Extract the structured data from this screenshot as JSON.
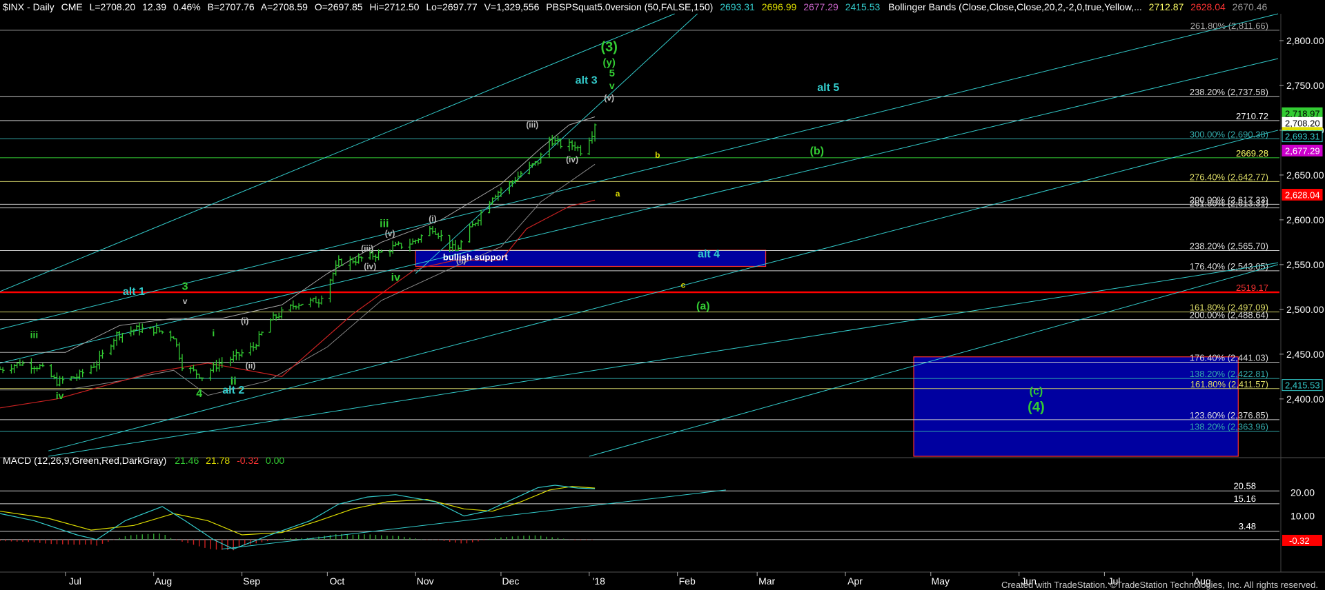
{
  "header": {
    "symbol": "$INX - Daily",
    "exchange": "CME",
    "last": "L=2708.20",
    "change": "12.39",
    "pct": "0.46%",
    "bid": "B=2707.76",
    "ask": "A=2708.59",
    "open": "O=2697.85",
    "high": "Hi=2712.50",
    "low": "Lo=2697.77",
    "volume": "V=1,329,556",
    "indicator_name": "PBSPSquat5.0version (50,FALSE,150)",
    "indicator_values": [
      "2693.31",
      "2696.99",
      "2677.29",
      "2415.53"
    ],
    "bb_name": "Bollinger Bands (Close,Close,Close,20,2,-2,0,true,Yellow,...",
    "bb_values": [
      "2712.87",
      "2628.04",
      "2670.46"
    ]
  },
  "colors": {
    "background": "#000000",
    "bar": "#33cc33",
    "trend_line": "#33cccc",
    "bb_line": "#aaaaaa",
    "support_box": "#0000a0",
    "box_border": "#ff3333",
    "wave_green": "#33cc33",
    "wave_cyan": "#33cccc",
    "wave_yellow": "#dddd00",
    "wave_gray": "#bbbbbb",
    "red_line": "#ff0000"
  },
  "chart_data": {
    "type": "ohlc",
    "price_axis": {
      "ylim": [
        2336,
        2830
      ],
      "ticks": [
        "2,800.00",
        "2,750.00",
        "2,700.00",
        "2,650.00",
        "2,600.00",
        "2,550.00",
        "2,500.00",
        "2,450.00",
        "2,400.00"
      ],
      "tick_values": [
        2800,
        2750,
        2700,
        2650,
        2600,
        2550,
        2500,
        2450,
        2400
      ]
    },
    "date_axis": {
      "months": [
        "Jul",
        "Aug",
        "Sep",
        "Oct",
        "Nov",
        "Dec",
        "'18",
        "Feb",
        "Mar",
        "Apr",
        "May",
        "Jun",
        "Jul",
        "Aug"
      ],
      "month_dates": [
        "2017-07-01",
        "2017-08-01",
        "2017-09-01",
        "2017-10-01",
        "2017-11-01",
        "2017-12-01",
        "2018-01-01",
        "2018-02-01",
        "2018-03-01",
        "2018-04-01",
        "2018-05-01",
        "2018-06-01",
        "2018-07-01",
        "2018-08-01"
      ],
      "xlim": [
        "2017-06-08",
        "2018-08-31"
      ]
    },
    "price_path": [
      [
        "2017-06-08",
        2433
      ],
      [
        "2017-06-15",
        2440
      ],
      [
        "2017-06-22",
        2436
      ],
      [
        "2017-06-28",
        2419
      ],
      [
        "2017-07-05",
        2425
      ],
      [
        "2017-07-12",
        2440
      ],
      [
        "2017-07-19",
        2472
      ],
      [
        "2017-07-26",
        2478
      ],
      [
        "2017-08-02",
        2477
      ],
      [
        "2017-08-08",
        2470
      ],
      [
        "2017-08-11",
        2438
      ],
      [
        "2017-08-18",
        2425
      ],
      [
        "2017-08-24",
        2440
      ],
      [
        "2017-08-29",
        2446
      ],
      [
        "2017-09-05",
        2458
      ],
      [
        "2017-09-11",
        2488
      ],
      [
        "2017-09-20",
        2506
      ],
      [
        "2017-09-28",
        2510
      ],
      [
        "2017-10-05",
        2552
      ],
      [
        "2017-10-12",
        2556
      ],
      [
        "2017-10-19",
        2562
      ],
      [
        "2017-10-24",
        2569
      ],
      [
        "2017-10-31",
        2575
      ],
      [
        "2017-11-07",
        2591
      ],
      [
        "2017-11-15",
        2565
      ],
      [
        "2017-11-22",
        2598
      ],
      [
        "2017-11-28",
        2627
      ],
      [
        "2017-12-04",
        2640
      ],
      [
        "2017-12-08",
        2652
      ],
      [
        "2017-12-14",
        2665
      ],
      [
        "2017-12-18",
        2690
      ],
      [
        "2017-12-22",
        2684
      ],
      [
        "2017-12-27",
        2683
      ],
      [
        "2017-12-29",
        2677
      ],
      [
        "2018-01-02",
        2697
      ],
      [
        "2018-01-03",
        2708
      ]
    ],
    "bb_upper": [
      [
        "2017-06-08",
        2452
      ],
      [
        "2017-07-01",
        2452
      ],
      [
        "2017-07-20",
        2482
      ],
      [
        "2017-08-08",
        2490
      ],
      [
        "2017-08-25",
        2490
      ],
      [
        "2017-09-15",
        2505
      ],
      [
        "2017-10-01",
        2540
      ],
      [
        "2017-10-20",
        2575
      ],
      [
        "2017-11-10",
        2600
      ],
      [
        "2017-12-01",
        2640
      ],
      [
        "2017-12-15",
        2680
      ],
      [
        "2017-12-25",
        2706
      ],
      [
        "2018-01-03",
        2715
      ]
    ],
    "bb_lower": [
      [
        "2017-06-08",
        2410
      ],
      [
        "2017-07-01",
        2410
      ],
      [
        "2017-07-20",
        2420
      ],
      [
        "2017-08-08",
        2432
      ],
      [
        "2017-08-20",
        2404
      ],
      [
        "2017-09-10",
        2420
      ],
      [
        "2017-10-01",
        2458
      ],
      [
        "2017-10-20",
        2510
      ],
      [
        "2017-11-15",
        2548
      ],
      [
        "2017-12-01",
        2570
      ],
      [
        "2017-12-15",
        2620
      ],
      [
        "2018-01-03",
        2662
      ]
    ],
    "ma_red": [
      [
        "2017-06-08",
        2390
      ],
      [
        "2017-06-28",
        2400
      ],
      [
        "2017-08-01",
        2430
      ],
      [
        "2017-08-20",
        2440
      ],
      [
        "2017-09-15",
        2425
      ],
      [
        "2017-10-10",
        2495
      ],
      [
        "2017-11-01",
        2545
      ],
      [
        "2017-11-15",
        2555
      ],
      [
        "2017-12-01",
        2555
      ],
      [
        "2017-12-10",
        2590
      ],
      [
        "2017-12-25",
        2615
      ],
      [
        "2018-01-03",
        2622
      ]
    ],
    "trend_lines": [
      [
        [
          "2017-06-08",
          2520
        ],
        [
          "2018-01-31",
          2830
        ]
      ],
      [
        [
          "2017-06-08",
          2478
        ],
        [
          "2018-08-31",
          2830
        ]
      ],
      [
        [
          "2017-06-08",
          2440
        ],
        [
          "2018-08-31",
          2780
        ]
      ],
      [
        [
          "2017-06-25",
          2342
        ],
        [
          "2018-08-31",
          2700
        ]
      ],
      [
        [
          "2017-06-25",
          2336
        ],
        [
          "2018-08-31",
          2552
        ]
      ],
      [
        [
          "2017-11-01",
          2540
        ],
        [
          "2018-02-08",
          2830
        ]
      ],
      [
        [
          "2018-01-01",
          2336
        ],
        [
          "2018-08-31",
          2550
        ]
      ]
    ],
    "hlines": [
      {
        "value": 2811.66,
        "color": "#999999",
        "label": "261.80% (2,811.66)",
        "label_color": "#aaaaaa"
      },
      {
        "value": 2737.58,
        "color": "#cccccc",
        "label": "238.20% (2,737.58)",
        "label_color": "#dddddd"
      },
      {
        "value": 2710.72,
        "color": "#dddddd",
        "label": "2710.72",
        "label_color": "#ffffff"
      },
      {
        "value": 2690.38,
        "color": "#33aaaa",
        "label": "300.00% (2,690.38)",
        "label_color": "#33aaaa"
      },
      {
        "value": 2669.28,
        "color": "#33cc33",
        "label": "2669.28",
        "label_color": "#ffff66"
      },
      {
        "value": 2642.77,
        "color": "#cccc66",
        "label": "276.40% (2,642.77)",
        "label_color": "#dddd66"
      },
      {
        "value": 2617.33,
        "color": "#cccccc",
        "label": "200.00% (2,617.33)",
        "label_color": "#dddddd"
      },
      {
        "value": 2613.31,
        "color": "#cccccc",
        "label": "261.80% (2,613.31)",
        "label_color": "#dddddd"
      },
      {
        "value": 2565.7,
        "color": "#cccccc",
        "label": "238.20% (2,565.70)",
        "label_color": "#dddddd"
      },
      {
        "value": 2543.05,
        "color": "#cccccc",
        "label": "176.40% (2,543.05)",
        "label_color": "#dddddd"
      },
      {
        "value": 2519.17,
        "color": "#ff0000",
        "label": "2519.17",
        "label_color": "#ff3333"
      },
      {
        "value": 2497.09,
        "color": "#cccc66",
        "label": "161.80% (2,497.09)",
        "label_color": "#dddd66"
      },
      {
        "value": 2488.64,
        "color": "#cccccc",
        "label": "200.00% (2,488.64)",
        "label_color": "#dddddd"
      },
      {
        "value": 2441.03,
        "color": "#cccccc",
        "label": "176.40% (2,441.03)",
        "label_color": "#dddddd"
      },
      {
        "value": 2422.81,
        "color": "#33aaaa",
        "label": "138.20% (2,422.81)",
        "label_color": "#33aaaa"
      },
      {
        "value": 2411.57,
        "color": "#cccc66",
        "label": "161.80% (2,411.57)",
        "label_color": "#dddd66"
      },
      {
        "value": 2376.85,
        "color": "#cccccc",
        "label": "123.60% (2,376.85)",
        "label_color": "#dddddd"
      },
      {
        "value": 2363.96,
        "color": "#33aaaa",
        "label": "138.20% (2,363.96)",
        "label_color": "#33aaaa"
      }
    ],
    "price_badges": [
      {
        "value": 2718.97,
        "text": "2,718.97",
        "bg": "#33cc33",
        "fg": "#000000"
      },
      {
        "value": 2708.2,
        "text": "2,708.20",
        "bg": "#ffffff",
        "fg": "#000000"
      },
      {
        "value": 2696.99,
        "text": "2,696.99",
        "bg": "#dddd00",
        "fg": "#000000"
      },
      {
        "value": 2693.31,
        "text": "2,693.31",
        "bg": "#000000",
        "fg": "#33cccc"
      },
      {
        "value": 2677.29,
        "text": "2,677.29",
        "bg": "#cc00cc",
        "fg": "#ffffff"
      },
      {
        "value": 2628.04,
        "text": "2,628.04",
        "bg": "#ff0000",
        "fg": "#ffffff"
      },
      {
        "value": 2415.53,
        "text": "2,415.53",
        "bg": "#000000",
        "fg": "#33cccc"
      }
    ],
    "boxes": [
      {
        "name": "bullish-support-box",
        "x0": "2017-11-01",
        "x1": "2018-03-04",
        "y0": 2566,
        "y1": 2548,
        "label": "bullish support"
      },
      {
        "name": "target-c-box",
        "x0": "2018-04-25",
        "x1": "2018-08-17",
        "y0": 2447,
        "y1": 2336,
        "label": ""
      }
    ],
    "wave_labels": [
      {
        "t": "(3)",
        "d": "2018-01-08",
        "v": 2788,
        "size": 20,
        "c": "#33cc33"
      },
      {
        "t": "(y)",
        "d": "2018-01-08",
        "v": 2772,
        "size": 15,
        "c": "#33cc33"
      },
      {
        "t": "5",
        "d": "2018-01-09",
        "v": 2760,
        "size": 15,
        "c": "#33cc33"
      },
      {
        "t": "v",
        "d": "2018-01-09",
        "v": 2746,
        "size": 14,
        "c": "#33cc33"
      },
      {
        "t": "alt 3",
        "d": "2017-12-31",
        "v": 2752,
        "size": 16,
        "c": "#33cccc"
      },
      {
        "t": "(v)",
        "d": "2018-01-08",
        "v": 2733,
        "size": 12,
        "c": "#bbbbbb"
      },
      {
        "t": "alt 5",
        "d": "2018-03-26",
        "v": 2744,
        "size": 16,
        "c": "#33cccc"
      },
      {
        "t": "(iii)",
        "d": "2017-12-12",
        "v": 2703,
        "size": 12,
        "c": "#bbbbbb"
      },
      {
        "t": "(iv)",
        "d": "2017-12-26",
        "v": 2664,
        "size": 12,
        "c": "#bbbbbb"
      },
      {
        "t": "b",
        "d": "2018-01-25",
        "v": 2669,
        "size": 12,
        "c": "#dddd00"
      },
      {
        "t": "(b)",
        "d": "2018-03-22",
        "v": 2673,
        "size": 16,
        "c": "#33cc33"
      },
      {
        "t": "a",
        "d": "2018-01-11",
        "v": 2626,
        "size": 12,
        "c": "#dddd00"
      },
      {
        "t": "(i)",
        "d": "2017-11-07",
        "v": 2598,
        "size": 12,
        "c": "#bbbbbb"
      },
      {
        "t": "iii",
        "d": "2017-10-21",
        "v": 2592,
        "size": 16,
        "c": "#33cc33"
      },
      {
        "t": "(v)",
        "d": "2017-10-23",
        "v": 2582,
        "size": 12,
        "c": "#bbbbbb"
      },
      {
        "t": "(iii)",
        "d": "2017-10-15",
        "v": 2565,
        "size": 12,
        "c": "#bbbbbb"
      },
      {
        "t": "(iv)",
        "d": "2017-10-16",
        "v": 2545,
        "size": 12,
        "c": "#bbbbbb"
      },
      {
        "t": "iv",
        "d": "2017-10-25",
        "v": 2532,
        "size": 16,
        "c": "#33cc33"
      },
      {
        "t": "(ii)",
        "d": "2017-11-17",
        "v": 2552,
        "size": 12,
        "c": "#bbbbbb"
      },
      {
        "t": "bullish support",
        "d": "2017-11-22",
        "v": 2555,
        "size": 13,
        "c": "#ffffff"
      },
      {
        "t": "alt 4",
        "d": "2018-02-12",
        "v": 2558,
        "size": 16,
        "c": "#33cccc"
      },
      {
        "t": "c",
        "d": "2018-02-03",
        "v": 2524,
        "size": 12,
        "c": "#dddd00"
      },
      {
        "t": "(a)",
        "d": "2018-02-10",
        "v": 2500,
        "size": 16,
        "c": "#33cc33"
      },
      {
        "t": "alt 1",
        "d": "2017-07-25",
        "v": 2516,
        "size": 16,
        "c": "#33cccc"
      },
      {
        "t": "3",
        "d": "2017-08-12",
        "v": 2522,
        "size": 16,
        "c": "#33cc33"
      },
      {
        "t": "v",
        "d": "2017-08-12",
        "v": 2506,
        "size": 12,
        "c": "#bbbbbb"
      },
      {
        "t": "iii",
        "d": "2017-06-20",
        "v": 2468,
        "size": 14,
        "c": "#33cc33"
      },
      {
        "t": "i",
        "d": "2017-08-22",
        "v": 2470,
        "size": 14,
        "c": "#33cc33"
      },
      {
        "t": "(i)",
        "d": "2017-09-02",
        "v": 2484,
        "size": 12,
        "c": "#bbbbbb"
      },
      {
        "t": "(ii)",
        "d": "2017-09-04",
        "v": 2434,
        "size": 12,
        "c": "#bbbbbb"
      },
      {
        "t": "ii",
        "d": "2017-08-29",
        "v": 2416,
        "size": 16,
        "c": "#33cc33"
      },
      {
        "t": "4",
        "d": "2017-08-17",
        "v": 2402,
        "size": 16,
        "c": "#33cc33"
      },
      {
        "t": "alt 2",
        "d": "2017-08-29",
        "v": 2406,
        "size": 16,
        "c": "#33cccc"
      },
      {
        "t": "iv",
        "d": "2017-06-29",
        "v": 2400,
        "size": 14,
        "c": "#33cc33"
      },
      {
        "t": "(c)",
        "d": "2018-06-07",
        "v": 2405,
        "size": 16,
        "c": "#33cc33"
      },
      {
        "t": "(4)",
        "d": "2018-06-07",
        "v": 2386,
        "size": 20,
        "c": "#33cc33"
      }
    ],
    "macd": {
      "label": "MACD (12,26,9,Green,Red,DarkGray)",
      "values": [
        "21.46",
        "21.78",
        "-0.32",
        "0.00"
      ],
      "ylim": [
        -5,
        30
      ],
      "ticks": [
        "20.00",
        "10.00"
      ],
      "tick_values": [
        20,
        10
      ],
      "hlines": [
        {
          "value": 20.58,
          "label": "20.58"
        },
        {
          "value": 15.16,
          "label": "15.16"
        },
        {
          "value": 3.48,
          "label": "3.48"
        },
        {
          "value": 0,
          "label": ""
        }
      ],
      "badge": {
        "value": -0.32,
        "text": "-0.32"
      },
      "macd_line": [
        [
          "2017-06-08",
          11
        ],
        [
          "2017-06-20",
          8
        ],
        [
          "2017-07-05",
          2
        ],
        [
          "2017-07-12",
          0
        ],
        [
          "2017-07-22",
          8
        ],
        [
          "2017-08-04",
          14
        ],
        [
          "2017-08-12",
          8
        ],
        [
          "2017-08-22",
          0
        ],
        [
          "2017-08-29",
          -4
        ],
        [
          "2017-09-11",
          2
        ],
        [
          "2017-09-25",
          8
        ],
        [
          "2017-10-05",
          15
        ],
        [
          "2017-10-15",
          18
        ],
        [
          "2017-10-25",
          19
        ],
        [
          "2017-11-08",
          16
        ],
        [
          "2017-11-18",
          10
        ],
        [
          "2017-11-26",
          12
        ],
        [
          "2017-12-05",
          17
        ],
        [
          "2017-12-14",
          22
        ],
        [
          "2017-12-20",
          23
        ],
        [
          "2017-12-28",
          21.8
        ],
        [
          "2018-01-03",
          21.5
        ]
      ],
      "signal_line": [
        [
          "2017-06-08",
          12
        ],
        [
          "2017-06-25",
          9
        ],
        [
          "2017-07-10",
          4
        ],
        [
          "2017-07-25",
          6
        ],
        [
          "2017-08-08",
          11
        ],
        [
          "2017-08-20",
          8
        ],
        [
          "2017-09-01",
          2
        ],
        [
          "2017-09-15",
          3
        ],
        [
          "2017-09-28",
          8
        ],
        [
          "2017-10-10",
          13
        ],
        [
          "2017-10-22",
          16
        ],
        [
          "2017-11-05",
          17
        ],
        [
          "2017-11-18",
          13
        ],
        [
          "2017-11-28",
          12
        ],
        [
          "2017-12-08",
          16
        ],
        [
          "2017-12-18",
          21
        ],
        [
          "2017-12-26",
          22.5
        ],
        [
          "2018-01-03",
          21.8
        ]
      ],
      "trend_line": [
        [
          "2017-08-25",
          -4
        ],
        [
          "2018-02-18",
          21
        ]
      ]
    }
  },
  "footer": {
    "text": "Created with TradeStation. ©TradeStation Technologies, Inc. All rights reserved."
  }
}
